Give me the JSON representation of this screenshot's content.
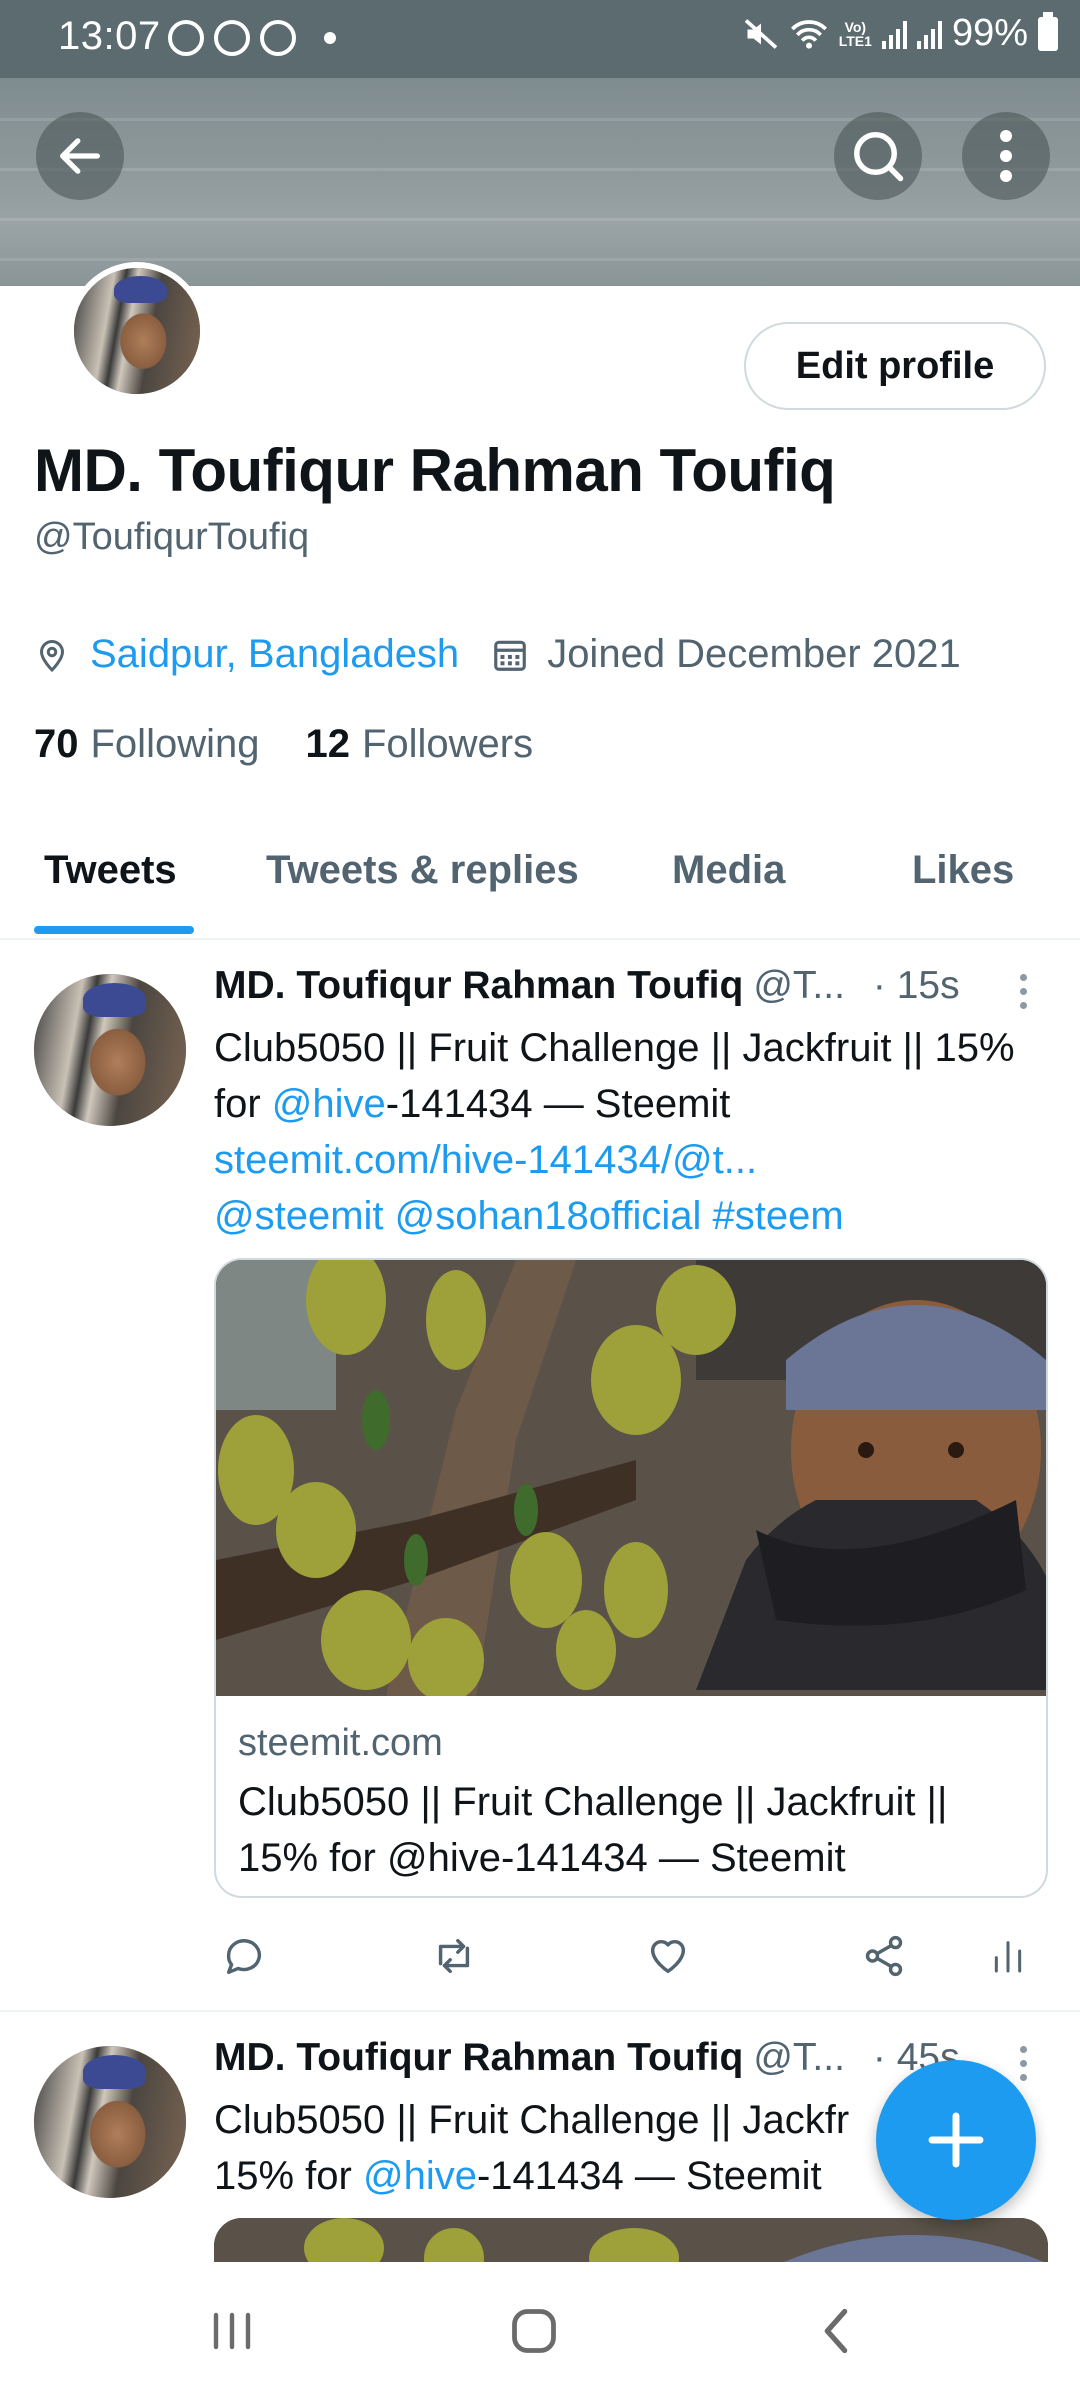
{
  "status_bar": {
    "time": "13:07",
    "battery": "99%",
    "notification_icons": [
      "messenger-icon",
      "whatsapp-icon",
      "messenger-icon"
    ]
  },
  "header": {
    "back_icon": "back-arrow-icon",
    "search_icon": "search-icon",
    "more_icon": "more-vertical-icon"
  },
  "profile": {
    "edit_button": "Edit profile",
    "name": "MD. Toufiqur Rahman Toufiq",
    "handle": "@ToufiqurToufiq",
    "location": "Saidpur, Bangladesh",
    "joined": "Joined December 2021",
    "following_count": "70",
    "following_label": "Following",
    "followers_count": "12",
    "followers_label": "Followers"
  },
  "tabs": [
    {
      "label": "Tweets",
      "active": true
    },
    {
      "label": "Tweets & replies",
      "active": false
    },
    {
      "label": "Media",
      "active": false
    },
    {
      "label": "Likes",
      "active": false
    }
  ],
  "tweets": [
    {
      "name": "MD. Toufiqur Rahman Toufiq",
      "handle": "@T...",
      "time": "· 15s",
      "text_part1": "Club5050 || Fruit Challenge || Jackfruit  || 15% for ",
      "mention_hive": "@hive",
      "text_part2": "-141434 — Steemit",
      "url": "steemit.com/hive-141434/@t...",
      "mention1": "@steemit",
      "mention2": "@sohan18official",
      "hashtag": "#steem",
      "card": {
        "domain": "steemit.com",
        "title": "Club5050 || Fruit Challenge || Jackfruit || 15% for @hive-141434 — Steemit"
      }
    },
    {
      "name": "MD. Toufiqur Rahman Toufiq",
      "handle": "@T...",
      "time": "· 45s",
      "text_part1": "Club5050 || Fruit Challenge || Jackfr",
      "mention_hive": "@hive",
      "text_part2": "-141434 — Steemit",
      "text_prefix2": "15% for "
    }
  ],
  "colors": {
    "accent": "#1d9bf0",
    "status_bar": "#5c6b70",
    "secondary_text": "#536471"
  }
}
